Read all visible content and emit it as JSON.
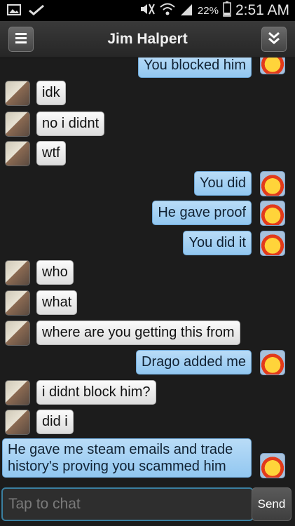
{
  "status_bar": {
    "icons": [
      "image-icon",
      "checkmark-icon",
      "mute-icon",
      "wifi-icon",
      "signal-icon",
      "battery-icon"
    ],
    "battery": "22%",
    "time": "2:51 AM"
  },
  "header": {
    "title": "Jim Halpert",
    "menu_icon": "hamburger-menu-icon",
    "collapse_icon": "double-chevron-down-icon"
  },
  "messages": [
    {
      "sender": "me",
      "text": "You blocked him"
    },
    {
      "sender": "Jim Halpert",
      "text": "idk"
    },
    {
      "sender": "Jim Halpert",
      "text": "no i didnt"
    },
    {
      "sender": "Jim Halpert",
      "text": "wtf"
    },
    {
      "sender": "me",
      "text": "You did"
    },
    {
      "sender": "me",
      "text": "He gave proof"
    },
    {
      "sender": "me",
      "text": "You did it"
    },
    {
      "sender": "Jim Halpert",
      "text": "who"
    },
    {
      "sender": "Jim Halpert",
      "text": "what"
    },
    {
      "sender": "Jim Halpert",
      "text": "where are you getting this from"
    },
    {
      "sender": "me",
      "text": "Drago added me"
    },
    {
      "sender": "Jim Halpert",
      "text": "i didnt block him?"
    },
    {
      "sender": "Jim Halpert",
      "text": "did i"
    },
    {
      "sender": "me",
      "text": "He gave me steam emails and trade history's proving you scammed him"
    }
  ],
  "input": {
    "placeholder": "Tap to chat",
    "send_label": "Send"
  },
  "colors": {
    "incoming_bubble": "#e6e6e6",
    "outgoing_bubble": "#a6d2f4",
    "input_border": "#3a7fa0",
    "background": "#1c1c1c"
  }
}
